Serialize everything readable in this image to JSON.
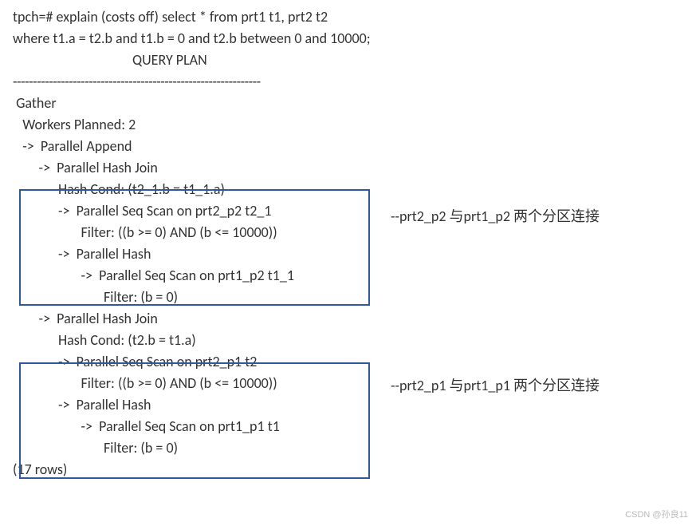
{
  "query": {
    "line1": "tpch=# explain (costs off) select * from prt1 t1, prt2 t2",
    "line2": "where t1.a = t2.b and t1.b = 0 and t2.b between 0 and 10000;",
    "header": "QUERY PLAN",
    "separator": "--------------------------------------------------------------"
  },
  "plan": {
    "gather": " Gather",
    "workers": "   Workers Planned: 2",
    "append": "   ->  Parallel Append",
    "join1": {
      "head": "        ->  Parallel Hash Join",
      "cond": "              Hash Cond: (t2_1.b = t1_1.a)",
      "scan1": "              ->  Parallel Seq Scan on prt2_p2 t2_1",
      "filter1": "                     Filter: ((b >= 0) AND (b <= 10000))",
      "hash": "              ->  Parallel Hash",
      "scan2": "                     ->  Parallel Seq Scan on prt1_p2 t1_1",
      "filter2": "                            Filter: (b = 0)"
    },
    "join2": {
      "head": "        ->  Parallel Hash Join",
      "cond": "              Hash Cond: (t2.b = t1.a)",
      "scan1": "              ->  Parallel Seq Scan on prt2_p1 t2",
      "filter1": "                     Filter: ((b >= 0) AND (b <= 10000))",
      "hash": "              ->  Parallel Hash",
      "scan2": "                     ->  Parallel Seq Scan on prt1_p1 t1",
      "filter2": "                            Filter: (b = 0)"
    },
    "rows": "(17 rows)"
  },
  "annotations": {
    "a1": "--prt2_p2 与prt1_p2 两个分区连接",
    "a2": "--prt2_p1 与prt1_p1 两个分区连接"
  },
  "watermark": "CSDN @孙良11"
}
